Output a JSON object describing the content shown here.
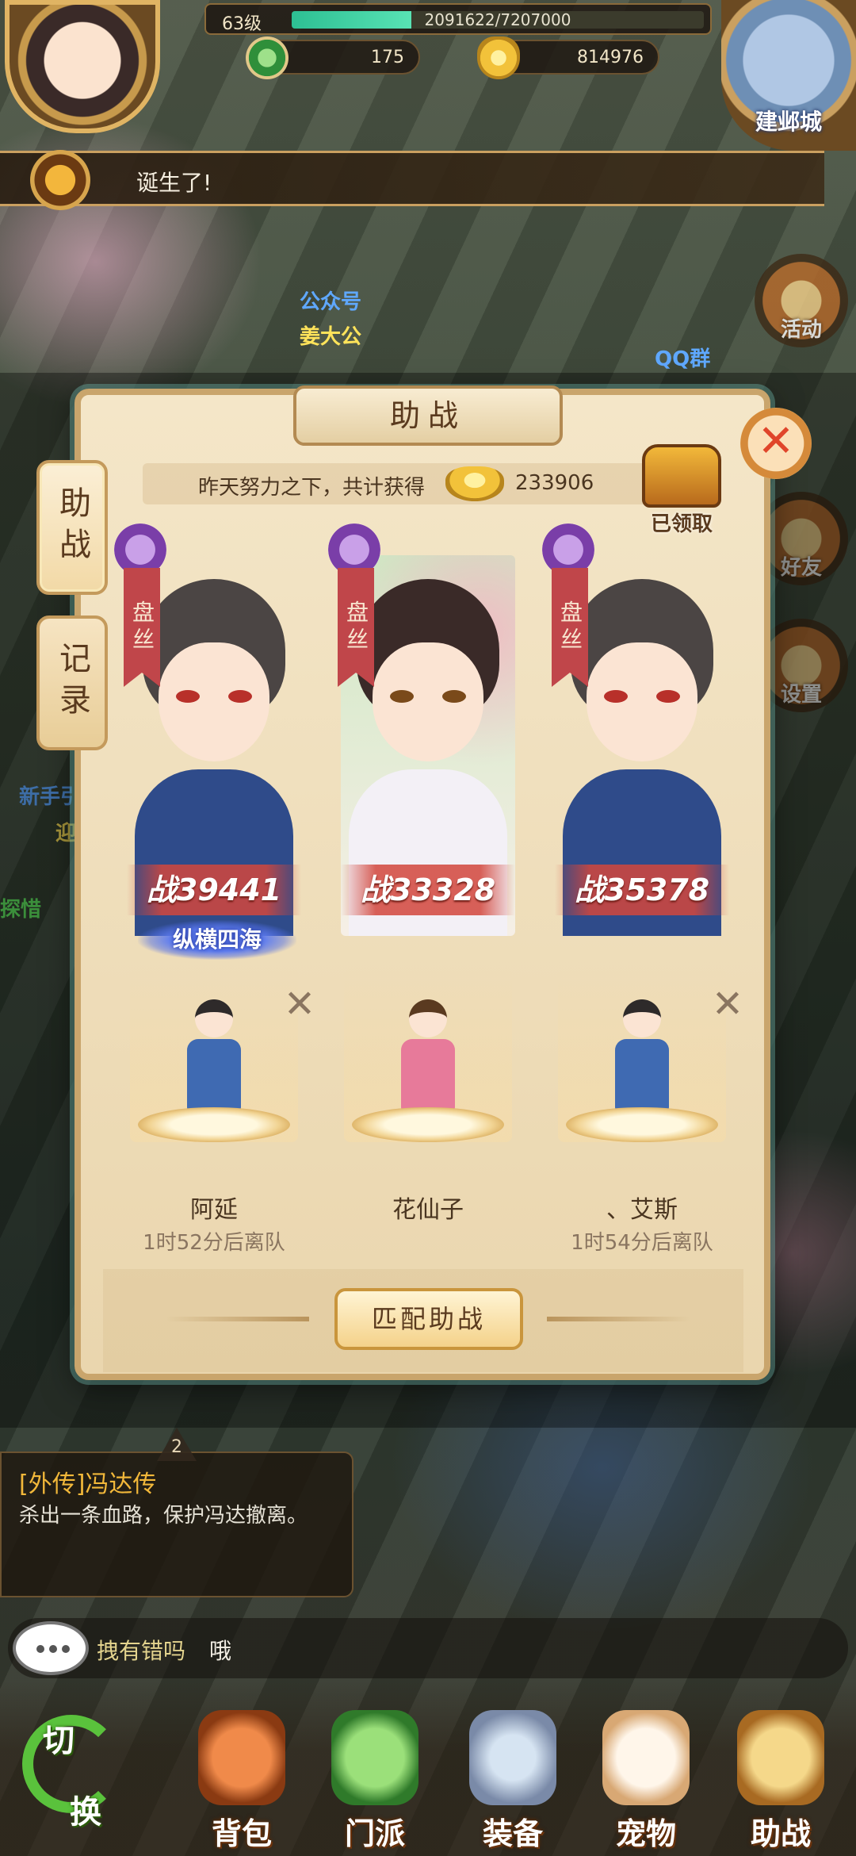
{
  "hud": {
    "level": "63级",
    "exp_text": "2091622/7207000",
    "exp_fraction": 0.29,
    "jade": "175",
    "gold": "814976",
    "city_label": "建邺城"
  },
  "announcement": {
    "text": "诞生了!"
  },
  "scene_labels": {
    "gzh": "公众号",
    "jdg": "姜大公",
    "qq": "QQ群",
    "newbie": "新手引",
    "welcome": "迎新",
    "explore": "探惜"
  },
  "side_buttons": {
    "activity": "活动",
    "friends": "好友",
    "settings": "设置"
  },
  "panel": {
    "title": "助战",
    "tabs": [
      "助战",
      "记录"
    ],
    "summary_text": "昨天努力之下，共计获得",
    "summary_value": "233906",
    "chest_label": "已领取",
    "match_button": "匹配助战"
  },
  "helpers": [
    {
      "sect": "盘丝",
      "power": "战39441",
      "title": "纵横四海",
      "name": "阿延",
      "leave": "1时52分后离队",
      "removable": true,
      "hair": "#4b4544",
      "body": "#2f4b8a"
    },
    {
      "sect": "盘丝",
      "power": "战33328",
      "title": "",
      "name": "花仙子",
      "leave": "",
      "removable": false,
      "hair": "#3a2a28",
      "body": "#f3f0f6"
    },
    {
      "sect": "盘丝",
      "power": "战35378",
      "title": "",
      "name": "、艾斯",
      "leave": "1时54分后离队",
      "removable": true,
      "hair": "#4b4544",
      "body": "#2f4b8a"
    }
  ],
  "quest": {
    "badge": "2",
    "title": "[外传]冯达传",
    "desc": "杀出一条血路，保护冯达撤离。"
  },
  "chat": {
    "user": "拽有错吗",
    "message": "哦"
  },
  "nav": {
    "switch_top": "切",
    "switch_bottom": "换",
    "items": [
      "背包",
      "门派",
      "装备",
      "宠物",
      "助战"
    ]
  },
  "colors": {
    "accent_red": "#c0464a",
    "gold": "#f2b83a",
    "panel_bg": "#f4e6c8",
    "exp_green": "#2dbf93"
  }
}
